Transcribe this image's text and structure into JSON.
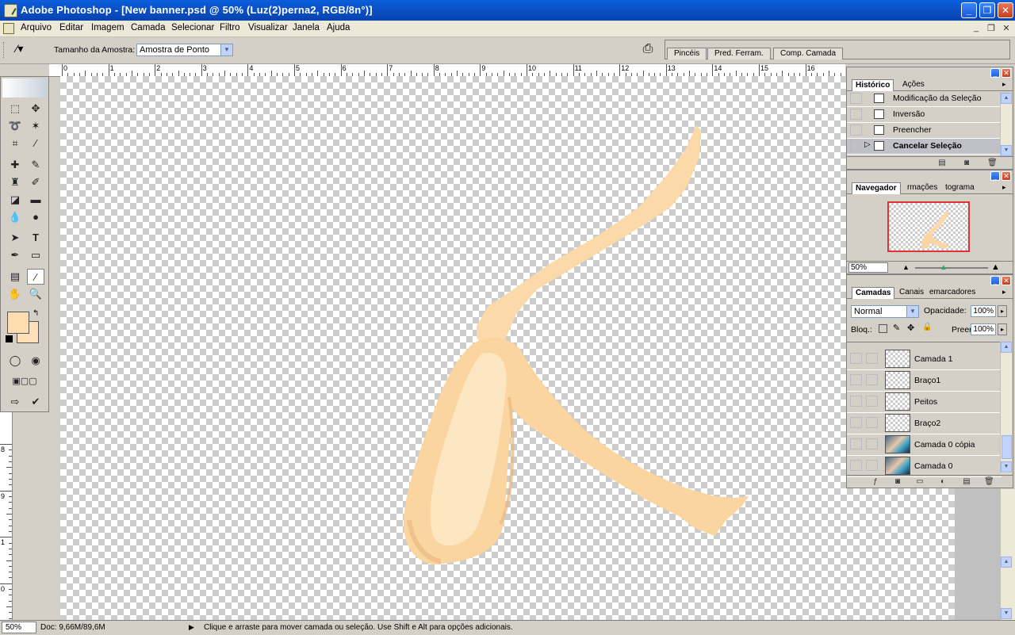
{
  "window": {
    "title": "Adobe Photoshop - [New banner.psd @ 50% (Luz(2)perna2, RGB/8n°)]",
    "min_label": "_",
    "max_label": "❐",
    "close_label": "✕"
  },
  "menu": {
    "items": [
      "Arquivo",
      "Editar",
      "Imagem",
      "Camada",
      "Selecionar",
      "Filtro",
      "Visualizar",
      "Janela",
      "Ajuda"
    ],
    "doc_controls": [
      "_",
      "❐",
      "✕"
    ]
  },
  "options_bar": {
    "tool_icon": "eyedropper-icon",
    "sample_size_label": "Tamanho da Amostra:",
    "sample_size_value": "Amostra de Ponto",
    "palette_well_tabs": [
      "Pincéis",
      "Pred. Ferram.",
      "Comp. Camada"
    ]
  },
  "rulers": {
    "horizontal": [
      "0",
      "1",
      "2",
      "3",
      "4",
      "5",
      "6",
      "7",
      "8",
      "9",
      "10",
      "11",
      "12",
      "13",
      "14",
      "15",
      "16"
    ],
    "vertical": [
      "8",
      "9",
      "1",
      "0"
    ]
  },
  "colors": {
    "foreground": "#fcdcb0",
    "background": "#fde0b8",
    "skin_light": "#fde3b9",
    "skin_mid": "#f8d09c",
    "skin_shade": "#e9b87e"
  },
  "history_panel": {
    "tabs": [
      "Histórico",
      "Ações"
    ],
    "items": [
      {
        "label": "Modificação da Seleção",
        "icon": "history-state-icon"
      },
      {
        "label": "Inversão",
        "icon": "history-state-icon"
      },
      {
        "label": "Preencher",
        "icon": "history-state-icon"
      },
      {
        "label": "Cancelar Seleção",
        "icon": "history-state-icon",
        "selected": true
      }
    ]
  },
  "navigator_panel": {
    "tabs": [
      "Navegador",
      "rmações",
      "tograma"
    ],
    "zoom": "50%"
  },
  "layers_panel": {
    "tabs": [
      "Camadas",
      "Canais",
      "emarcadores"
    ],
    "blend_mode": "Normal",
    "opacity_label": "Opacidade:",
    "opacity_value": "100%",
    "lock_label": "Bloq.:",
    "fill_label": "Preen.:",
    "fill_value": "100%",
    "layers": [
      {
        "name": "Camada 1",
        "thumb": "transparent"
      },
      {
        "name": "Braço1",
        "thumb": "transparent"
      },
      {
        "name": "Peitos",
        "thumb": "transparent"
      },
      {
        "name": "Braço2",
        "thumb": "transparent"
      },
      {
        "name": "Camada 0 cópia",
        "thumb": "photo"
      },
      {
        "name": "Camada 0",
        "thumb": "photo"
      }
    ]
  },
  "status_bar": {
    "zoom": "50%",
    "doc_info": "Doc: 9,66M/89,6M",
    "hint": "Clique e arraste para mover camada ou seleção.  Use Shift e Alt para opções adicionais."
  }
}
